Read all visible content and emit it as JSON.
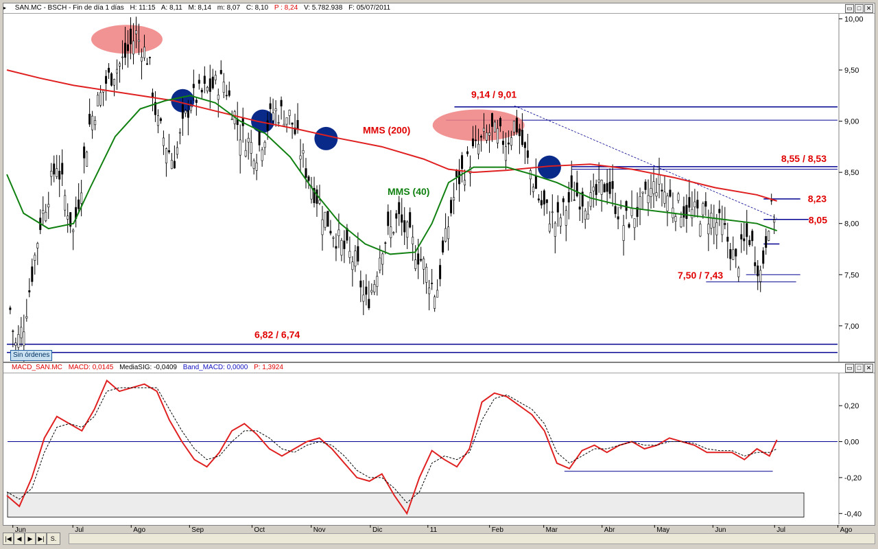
{
  "main_title": {
    "symbol": "SAN.MC - BSCH - Fin de día 1 días",
    "open": "H: 11:15",
    "a": "A: 8,11",
    "m": "M: 8,14",
    "min": "m: 8,07",
    "close": "C: 8,10",
    "p": "P : 8,24",
    "volume": "V: 5.782.938",
    "date": "F: 05/07/2011"
  },
  "macd_title": {
    "name": "MACD_SAN.MC",
    "macd": "MACD: 0,0145",
    "signal": "MediaSIG: -0,0409",
    "band": "Band_MACD: 0,0000",
    "p": "P: 1,3924"
  },
  "window_buttons": [
    "▭",
    "□",
    "✕"
  ],
  "sin_ordenes": "Sin órdenes",
  "x_labels": [
    "Jun",
    "Jul",
    "Ago",
    "Sep",
    "Oct",
    "Nov",
    "Dic",
    "11",
    "Feb",
    "Mar",
    "Abr",
    "May",
    "Jun",
    "Jul",
    "Ago"
  ],
  "nav": {
    "prev_all": "|◀",
    "prev": "◀",
    "next": "▶",
    "next_all": "▶|",
    "mode": "S."
  },
  "chart_data": [
    {
      "type": "candlestick",
      "y_ticks": [
        "10,00",
        "9,50",
        "9,00",
        "8,50",
        "8,00",
        "7,50",
        "7,00"
      ],
      "ylim": [
        6.65,
        10.05
      ],
      "annotations": {
        "mms200": "MMS (200)",
        "mms40": "MMS (40)",
        "level_914": "9,14 / 9,01",
        "level_855": "8,55 / 8,53",
        "level_823": "8,23",
        "level_805": "8,05",
        "level_750": "7,50 / 7,43",
        "level_682": "6,82 / 6,74"
      },
      "colors": {
        "mms200": "#e02020",
        "mms40": "#108010",
        "levels": "#000090",
        "label": "#e00000",
        "ellipse": "#f08080",
        "circle": "#0a2a8a"
      },
      "series": [
        {
          "name": "MMS (200)",
          "x": [
            0,
            0.04,
            0.08,
            0.12,
            0.16,
            0.2,
            0.25,
            0.3,
            0.35,
            0.4,
            0.45,
            0.5,
            0.53,
            0.56,
            0.6,
            0.65,
            0.7,
            0.75,
            0.8,
            0.85,
            0.9,
            0.924
          ],
          "values": [
            9.5,
            9.42,
            9.35,
            9.3,
            9.25,
            9.2,
            9.1,
            9.0,
            8.92,
            8.83,
            8.75,
            8.63,
            8.53,
            8.5,
            8.52,
            8.56,
            8.58,
            8.53,
            8.45,
            8.35,
            8.28,
            8.22
          ]
        },
        {
          "name": "MMS (40)",
          "x": [
            0,
            0.02,
            0.05,
            0.08,
            0.1,
            0.13,
            0.16,
            0.19,
            0.22,
            0.25,
            0.28,
            0.31,
            0.34,
            0.37,
            0.4,
            0.43,
            0.46,
            0.49,
            0.51,
            0.53,
            0.56,
            0.6,
            0.63,
            0.66,
            0.7,
            0.75,
            0.8,
            0.85,
            0.9,
            0.924
          ],
          "values": [
            8.48,
            8.1,
            7.95,
            8.0,
            8.35,
            8.85,
            9.12,
            9.2,
            9.25,
            9.18,
            9.0,
            8.88,
            8.65,
            8.3,
            8.0,
            7.8,
            7.7,
            7.72,
            8.0,
            8.4,
            8.55,
            8.55,
            8.48,
            8.4,
            8.25,
            8.15,
            8.1,
            8.05,
            8.0,
            7.93
          ]
        }
      ]
    },
    {
      "type": "line",
      "y_ticks": [
        "0,20",
        "0,00",
        "-0,20",
        "-0,40"
      ],
      "ylim": [
        -0.46,
        0.38
      ],
      "series": [
        {
          "name": "MACD",
          "x": [
            0,
            0.015,
            0.03,
            0.045,
            0.06,
            0.075,
            0.09,
            0.105,
            0.12,
            0.135,
            0.15,
            0.165,
            0.18,
            0.195,
            0.21,
            0.225,
            0.24,
            0.255,
            0.27,
            0.285,
            0.3,
            0.315,
            0.33,
            0.345,
            0.36,
            0.375,
            0.39,
            0.405,
            0.42,
            0.435,
            0.45,
            0.465,
            0.48,
            0.495,
            0.51,
            0.525,
            0.54,
            0.555,
            0.57,
            0.585,
            0.6,
            0.615,
            0.63,
            0.645,
            0.66,
            0.675,
            0.69,
            0.705,
            0.72,
            0.735,
            0.75,
            0.765,
            0.78,
            0.795,
            0.81,
            0.825,
            0.84,
            0.855,
            0.87,
            0.885,
            0.9,
            0.915,
            0.924
          ],
          "values": [
            -0.3,
            -0.36,
            -0.2,
            0.02,
            0.14,
            0.1,
            0.06,
            0.18,
            0.34,
            0.28,
            0.3,
            0.32,
            0.28,
            0.12,
            0.0,
            -0.1,
            -0.14,
            -0.06,
            0.06,
            0.1,
            0.04,
            -0.04,
            -0.08,
            -0.04,
            0.0,
            0.02,
            -0.04,
            -0.12,
            -0.2,
            -0.22,
            -0.18,
            -0.3,
            -0.4,
            -0.2,
            -0.05,
            -0.1,
            -0.14,
            -0.04,
            0.22,
            0.27,
            0.25,
            0.2,
            0.15,
            0.06,
            -0.12,
            -0.15,
            -0.05,
            -0.02,
            -0.06,
            -0.02,
            0.0,
            -0.04,
            -0.02,
            0.02,
            0.0,
            -0.02,
            -0.06,
            -0.06,
            -0.06,
            -0.1,
            -0.04,
            -0.08,
            0.01
          ]
        },
        {
          "name": "MediaSIG",
          "x": [
            0,
            0.015,
            0.03,
            0.045,
            0.06,
            0.075,
            0.09,
            0.105,
            0.12,
            0.135,
            0.15,
            0.165,
            0.18,
            0.195,
            0.21,
            0.225,
            0.24,
            0.255,
            0.27,
            0.285,
            0.3,
            0.315,
            0.33,
            0.345,
            0.36,
            0.375,
            0.39,
            0.405,
            0.42,
            0.435,
            0.45,
            0.465,
            0.48,
            0.495,
            0.51,
            0.525,
            0.54,
            0.555,
            0.57,
            0.585,
            0.6,
            0.615,
            0.63,
            0.645,
            0.66,
            0.675,
            0.69,
            0.705,
            0.72,
            0.735,
            0.75,
            0.765,
            0.78,
            0.795,
            0.81,
            0.825,
            0.84,
            0.855,
            0.87,
            0.885,
            0.9,
            0.915,
            0.924
          ],
          "values": [
            -0.28,
            -0.32,
            -0.26,
            -0.06,
            0.08,
            0.1,
            0.08,
            0.14,
            0.28,
            0.3,
            0.3,
            0.3,
            0.3,
            0.18,
            0.06,
            -0.04,
            -0.1,
            -0.08,
            0.0,
            0.06,
            0.06,
            0.02,
            -0.04,
            -0.06,
            -0.02,
            0.0,
            -0.02,
            -0.08,
            -0.16,
            -0.2,
            -0.2,
            -0.26,
            -0.34,
            -0.28,
            -0.12,
            -0.08,
            -0.1,
            -0.06,
            0.12,
            0.24,
            0.26,
            0.22,
            0.18,
            0.1,
            -0.06,
            -0.12,
            -0.08,
            -0.04,
            -0.04,
            -0.02,
            0.0,
            -0.02,
            -0.02,
            0.0,
            0.0,
            -0.01,
            -0.04,
            -0.05,
            -0.05,
            -0.08,
            -0.06,
            -0.06,
            -0.04
          ]
        }
      ]
    }
  ]
}
